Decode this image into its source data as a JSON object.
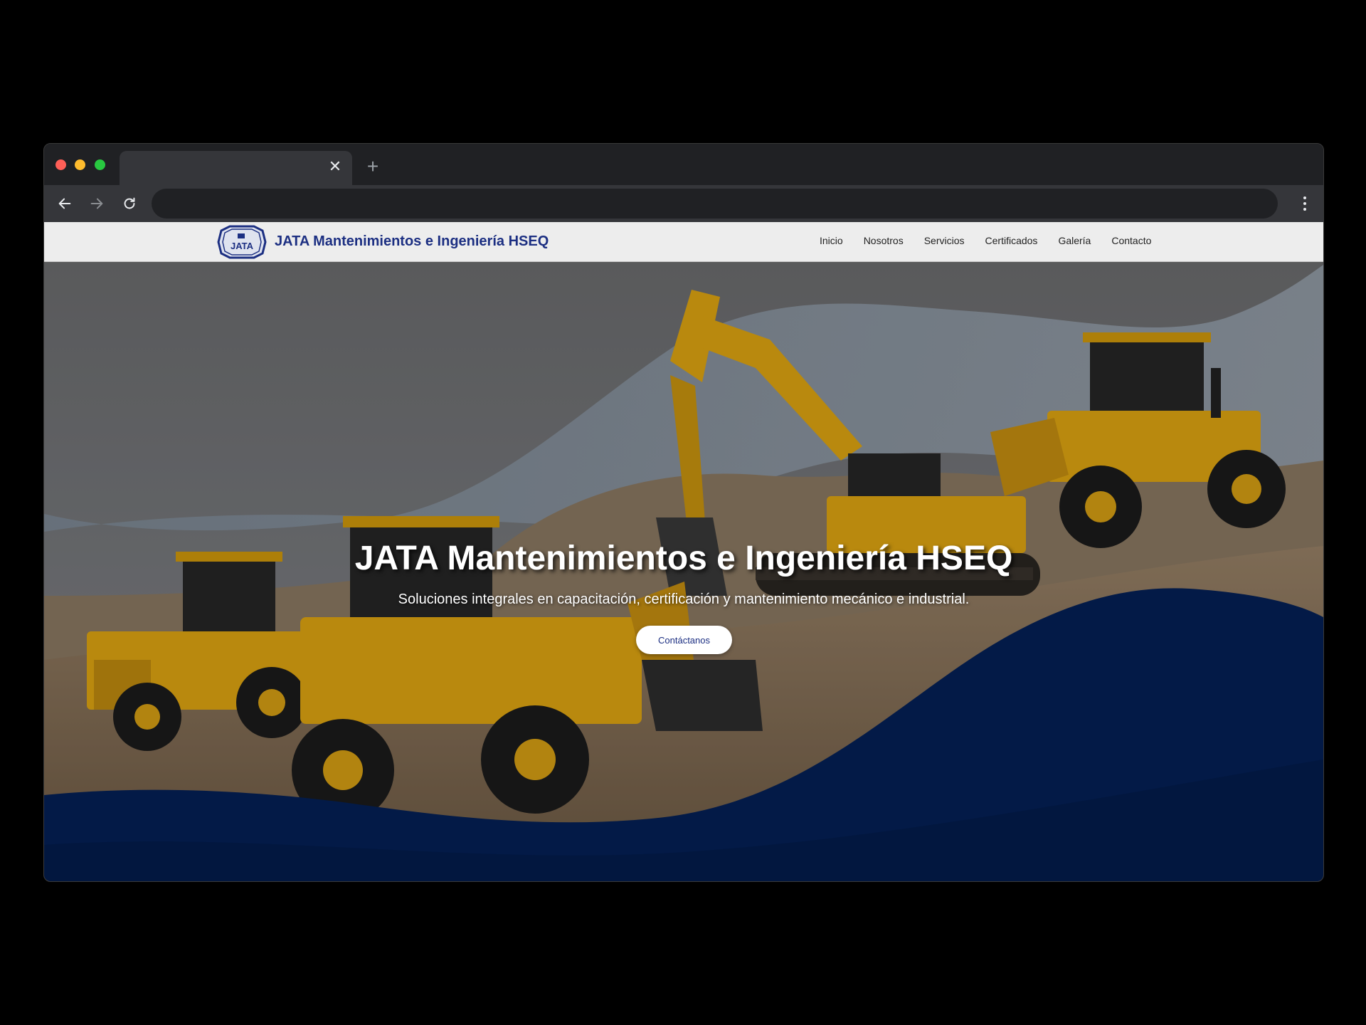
{
  "browser": {
    "tab_title": "",
    "tab_close_glyph": "✕",
    "new_tab_glyph": "+",
    "url": "",
    "icons": {
      "back": "arrow-left-icon",
      "forward": "arrow-right-icon",
      "reload": "reload-icon",
      "menu": "kebab-menu-icon"
    }
  },
  "site": {
    "logo_text": "JATA",
    "brand_name": "JATA Mantenimientos e Ingeniería HSEQ",
    "nav": [
      {
        "label": "Inicio"
      },
      {
        "label": "Nosotros"
      },
      {
        "label": "Servicios"
      },
      {
        "label": "Certificados"
      },
      {
        "label": "Galería"
      },
      {
        "label": "Contacto"
      }
    ]
  },
  "hero": {
    "title": "JATA Mantenimientos e Ingeniería HSEQ",
    "subtitle": "Soluciones integrales en capacitación, certificación y mantenimiento mecánico e industrial.",
    "cta_label": "Contáctanos"
  },
  "colors": {
    "brand_blue": "#1c2f82",
    "wave_navy": "#031a47",
    "machine_yellow": "#e2a812"
  }
}
